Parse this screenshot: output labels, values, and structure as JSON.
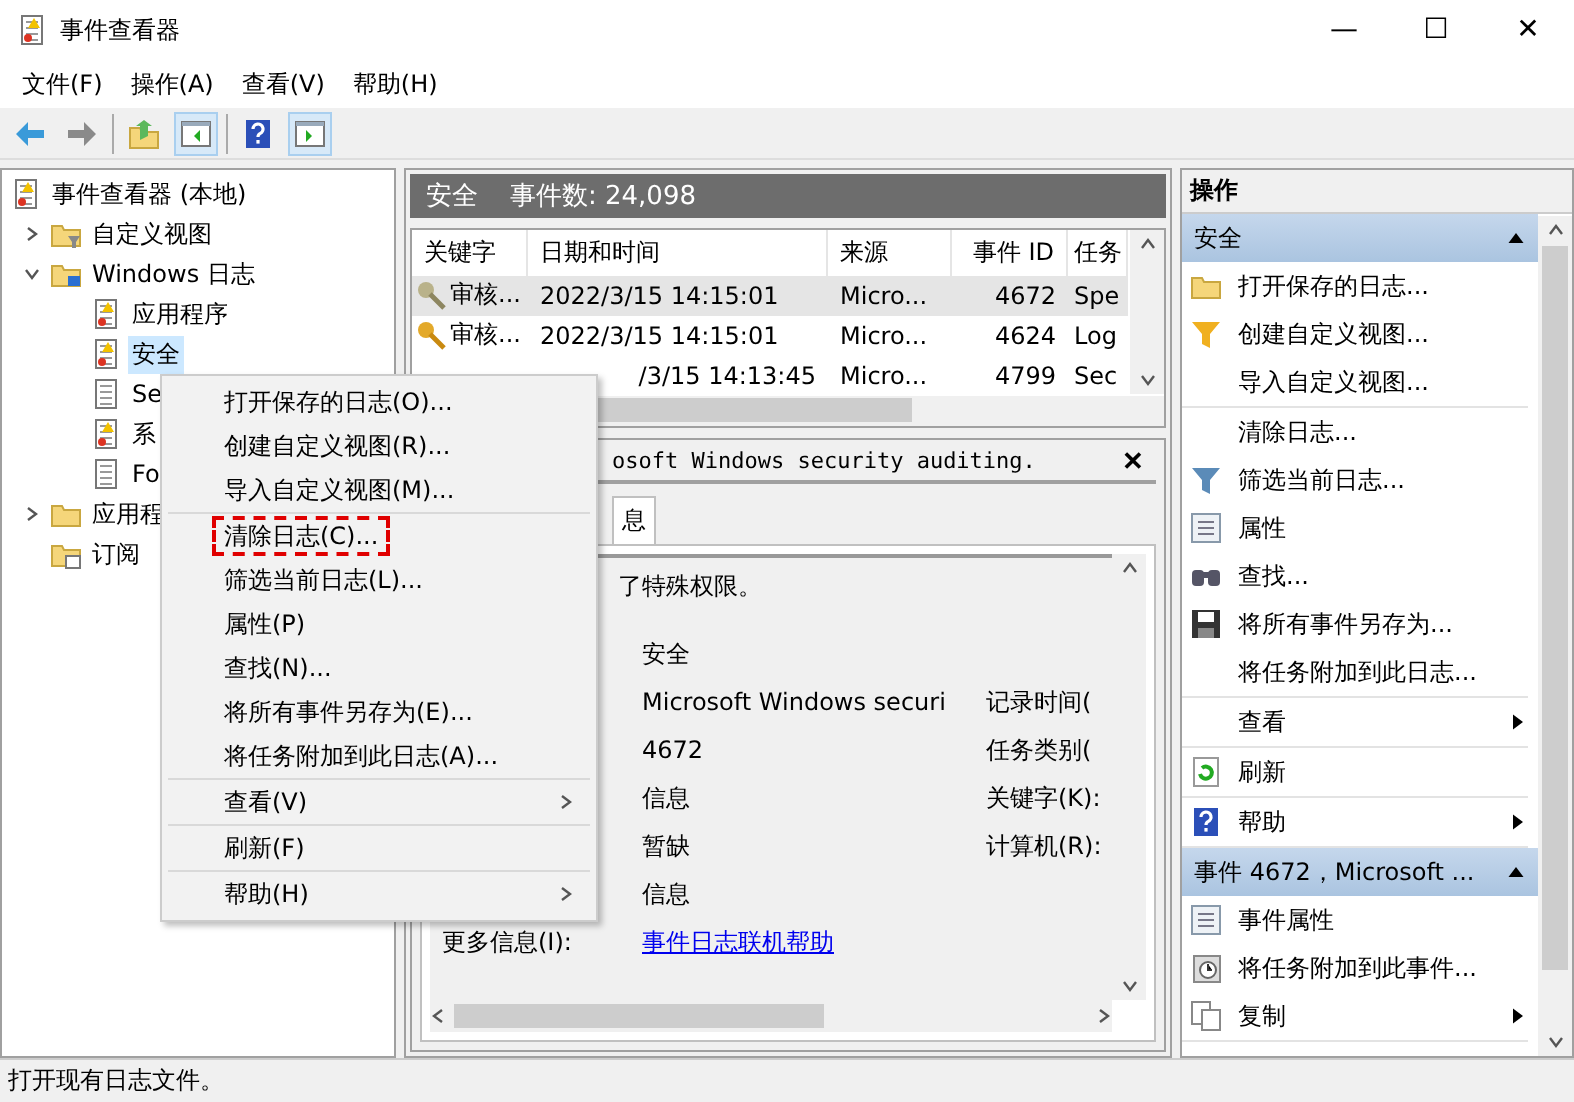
{
  "window": {
    "title": "事件查看器",
    "controls": [
      "—",
      "☐",
      "✕"
    ]
  },
  "menubar": [
    {
      "label": "文件(F)"
    },
    {
      "label": "操作(A)"
    },
    {
      "label": "查看(V)"
    },
    {
      "label": "帮助(H)"
    }
  ],
  "toolbar": [
    {
      "kind": "back",
      "on": false
    },
    {
      "kind": "forward",
      "on": false
    },
    {
      "kind": "folder-up",
      "on": false
    },
    {
      "kind": "pane-left",
      "on": true
    },
    {
      "kind": "help",
      "on": false
    },
    {
      "kind": "pane-right",
      "on": true
    }
  ],
  "tree": [
    {
      "label": "事件查看器 (本地)",
      "kind": "root",
      "selected": false,
      "children": [
        {
          "label": "自定义视图",
          "kind": "filter-folder",
          "selected": false,
          "expanded": false
        },
        {
          "label": "Windows 日志",
          "kind": "win-folder",
          "selected": false,
          "expanded": true,
          "children": [
            {
              "label": "应用程序",
              "kind": "log-warn",
              "selected": false
            },
            {
              "label": "安全",
              "kind": "log-warn",
              "selected": true
            },
            {
              "label": "Se",
              "kind": "log",
              "selected": false
            },
            {
              "label": "系",
              "kind": "log-warn",
              "selected": false
            },
            {
              "label": "Fo",
              "kind": "log",
              "selected": false
            }
          ]
        },
        {
          "label": "应用程",
          "kind": "folder",
          "selected": false,
          "expanded": false
        },
        {
          "label": "订阅",
          "kind": "sub-folder",
          "selected": false
        }
      ]
    }
  ],
  "log_header": {
    "name": "安全",
    "count": "事件数: 24,098"
  },
  "events": {
    "columns": [
      "关键字",
      "日期和时间",
      "来源",
      "事件 ID",
      "任务"
    ],
    "rows": [
      {
        "selected": true,
        "partial": false,
        "cells": [
          "审核...",
          "2022/3/15 14:15:01",
          "Micro...",
          "4672",
          "Spe"
        ]
      },
      {
        "selected": false,
        "partial": false,
        "cells": [
          "审核...",
          "2022/3/15 14:15:01",
          "Micro...",
          "4624",
          "Log"
        ]
      },
      {
        "selected": false,
        "partial": true,
        "cells": [
          "",
          "/3/15 14:13:45",
          "Micro...",
          "4799",
          "Sec"
        ]
      }
    ]
  },
  "detail": {
    "title": "osoft Windows security auditing.",
    "close": "✕",
    "tabs": [
      {
        "label": "息",
        "selected": true
      }
    ],
    "description": "了特殊权限。",
    "values": [
      "安全",
      "Microsoft Windows securi",
      "4672",
      "信息",
      "暂缺",
      "信息"
    ],
    "right_labels": [
      "记录时间(",
      "任务类别(",
      "关键字(K):",
      "计算机(R):"
    ],
    "more_label": "更多信息(I):",
    "link": "事件日志联机帮助"
  },
  "actions": {
    "title": "操作",
    "sections": [
      {
        "title": "安全",
        "expanded": true,
        "groups": [
          [
            {
              "label": "打开保存的日志...",
              "kind": "folder"
            },
            {
              "label": "创建自定义视图...",
              "kind": "filter-gold"
            },
            {
              "label": "导入自定义视图...",
              "kind": "plain"
            }
          ],
          [
            {
              "label": "清除日志...",
              "kind": "plain"
            },
            {
              "label": "筛选当前日志...",
              "kind": "filter"
            },
            {
              "label": "属性",
              "kind": "properties"
            },
            {
              "label": "查找...",
              "kind": "binoculars"
            },
            {
              "label": "将所有事件另存为...",
              "kind": "disk"
            },
            {
              "label": "将任务附加到此日志...",
              "kind": "plain"
            }
          ],
          [
            {
              "label": "查看",
              "kind": "plain",
              "submenu": true
            }
          ],
          [
            {
              "label": "刷新",
              "kind": "refresh"
            }
          ],
          [
            {
              "label": "帮助",
              "kind": "help",
              "submenu": true
            }
          ]
        ]
      },
      {
        "title": "事件 4672，Microsoft ...",
        "expanded": true,
        "groups": [
          [
            {
              "label": "事件属性",
              "kind": "properties"
            },
            {
              "label": "将任务附加到此事件...",
              "kind": "clock"
            },
            {
              "label": "复制",
              "kind": "copy",
              "submenu": true
            }
          ]
        ]
      }
    ]
  },
  "context_menu": {
    "groups": [
      [
        {
          "label": "打开保存的日志(O)...",
          "annotated": false
        },
        {
          "label": "创建自定义视图(R)...",
          "annotated": false
        },
        {
          "label": "导入自定义视图(M)...",
          "annotated": false
        }
      ],
      [
        {
          "label": "清除日志(C)...",
          "annotated": true
        },
        {
          "label": "筛选当前日志(L)...",
          "annotated": false
        },
        {
          "label": "属性(P)",
          "annotated": false
        },
        {
          "label": "查找(N)...",
          "annotated": false
        },
        {
          "label": "将所有事件另存为(E)...",
          "annotated": false
        },
        {
          "label": "将任务附加到此日志(A)...",
          "annotated": false
        }
      ],
      [
        {
          "label": "查看(V)",
          "annotated": false,
          "submenu": true
        }
      ],
      [
        {
          "label": "刷新(F)",
          "annotated": false
        }
      ],
      [
        {
          "label": "帮助(H)",
          "annotated": false,
          "submenu": true
        }
      ]
    ]
  },
  "status_bar": {
    "text": "打开现有日志文件。"
  }
}
